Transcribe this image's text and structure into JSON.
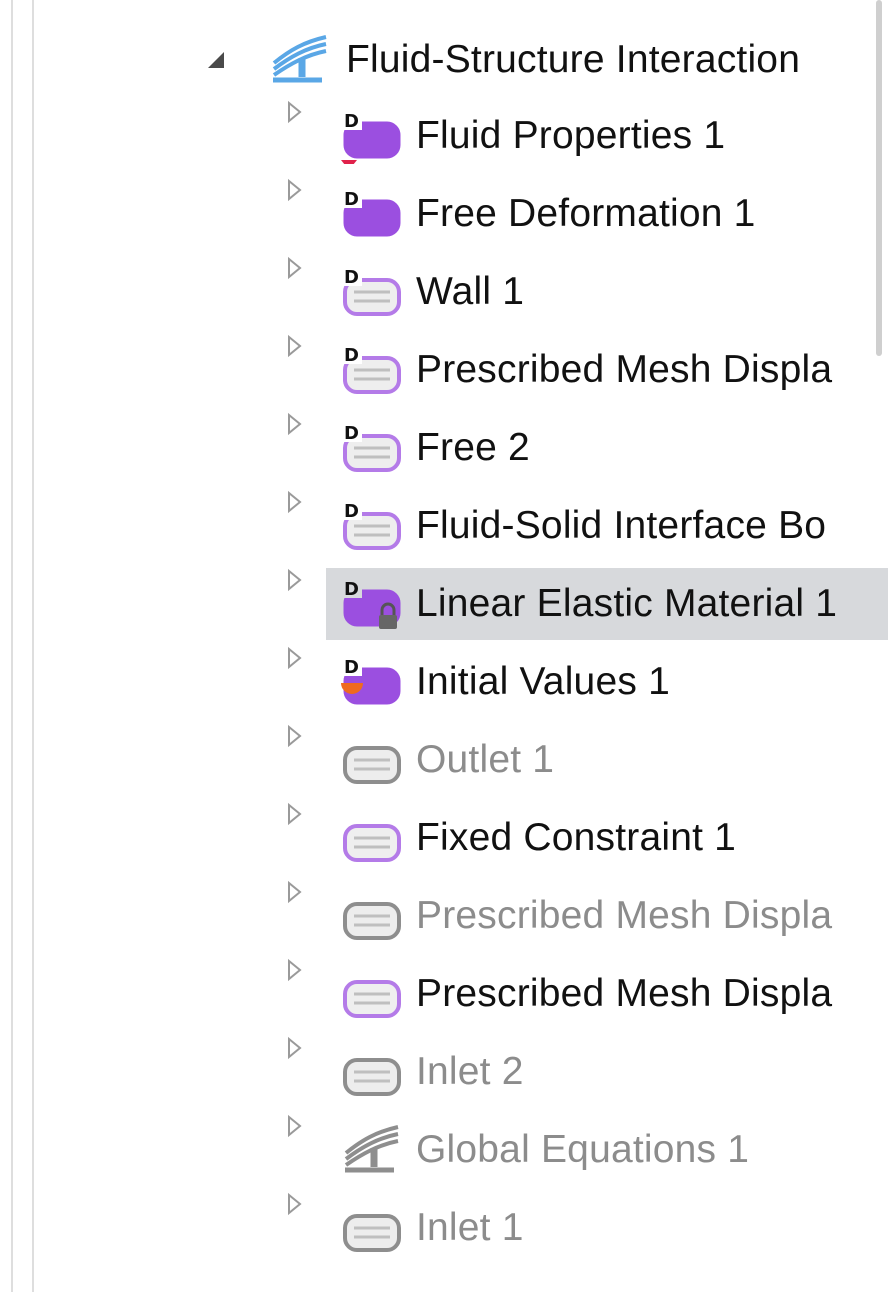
{
  "tree": {
    "root": {
      "label": "Fluid-Structure Interaction",
      "icon": "fsi-physics-icon",
      "expanded": true
    },
    "items": [
      {
        "label": "Fluid Properties 1",
        "icon": "domain-feature-icon",
        "state": "active"
      },
      {
        "label": "Free Deformation 1",
        "icon": "domain-feature-icon",
        "state": "active"
      },
      {
        "label": "Wall 1",
        "icon": "boundary-feature-icon",
        "state": "active"
      },
      {
        "label": "Prescribed Mesh Displa",
        "icon": "boundary-feature-icon",
        "state": "active"
      },
      {
        "label": "Free 2",
        "icon": "boundary-feature-icon",
        "state": "active"
      },
      {
        "label": "Fluid-Solid Interface Bo",
        "icon": "boundary-feature-icon",
        "state": "active"
      },
      {
        "label": "Linear Elastic Material 1",
        "icon": "locked-domain-feature-icon",
        "state": "selected"
      },
      {
        "label": "Initial Values 1",
        "icon": "initial-values-icon",
        "state": "active"
      },
      {
        "label": "Outlet 1",
        "icon": "boundary-icon",
        "state": "disabled"
      },
      {
        "label": "Fixed Constraint 1",
        "icon": "boundary-icon",
        "state": "active"
      },
      {
        "label": "Prescribed Mesh Displa",
        "icon": "boundary-icon",
        "state": "disabled"
      },
      {
        "label": "Prescribed Mesh Displa",
        "icon": "boundary-icon",
        "state": "active"
      },
      {
        "label": "Inlet 2",
        "icon": "boundary-icon",
        "state": "disabled"
      },
      {
        "label": "Global Equations 1",
        "icon": "global-equations-icon",
        "state": "disabled"
      },
      {
        "label": "Inlet 1",
        "icon": "boundary-icon",
        "state": "disabled"
      }
    ]
  },
  "colors": {
    "purple_fill": "#9b4fe0",
    "purple_outline": "#b47be8",
    "light_fill": "#e9e9e9",
    "disabled_outline": "#8e8e8e",
    "physics_blue": "#5aa7e6",
    "selection": "#d7d9dc",
    "red_marker": "#e0214a",
    "orange_marker": "#ef6a1f"
  }
}
